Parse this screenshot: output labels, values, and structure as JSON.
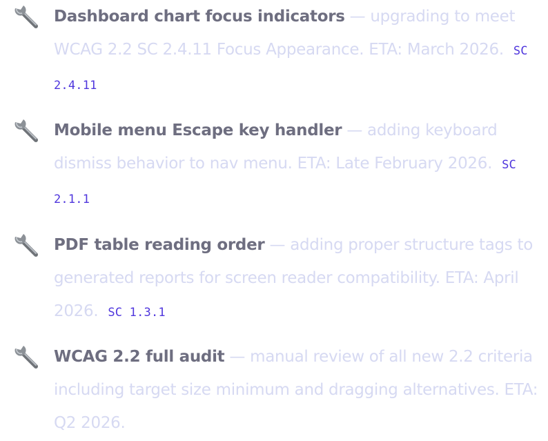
{
  "items": [
    {
      "icon": "wrench-icon",
      "title": "Dashboard chart focus indicators",
      "separator": " — ",
      "description": "upgrading to meet WCAG 2.2 SC 2.4.11 Focus Appearance. ETA: March 2026.",
      "badge": "SC 2.4.11"
    },
    {
      "icon": "wrench-icon",
      "title": "Mobile menu Escape key handler",
      "separator": " — ",
      "description": "adding keyboard dismiss behavior to nav menu. ETA: Late February 2026.",
      "badge": "SC 2.1.1"
    },
    {
      "icon": "wrench-icon",
      "title": "PDF table reading order",
      "separator": " — ",
      "description": "adding proper structure tags to generated reports for screen reader compatibility. ETA: April 2026.",
      "badge": "SC 1.3.1"
    },
    {
      "icon": "wrench-icon",
      "title": "WCAG 2.2 full audit",
      "separator": " — ",
      "description": "manual review of all new 2.2 criteria including target size minimum and dragging alternatives. ETA: Q2 2026.",
      "badge": ""
    }
  ],
  "colors": {
    "title": "#6e6e80",
    "description": "#d6d9f2",
    "badge": "#4f36dd"
  }
}
